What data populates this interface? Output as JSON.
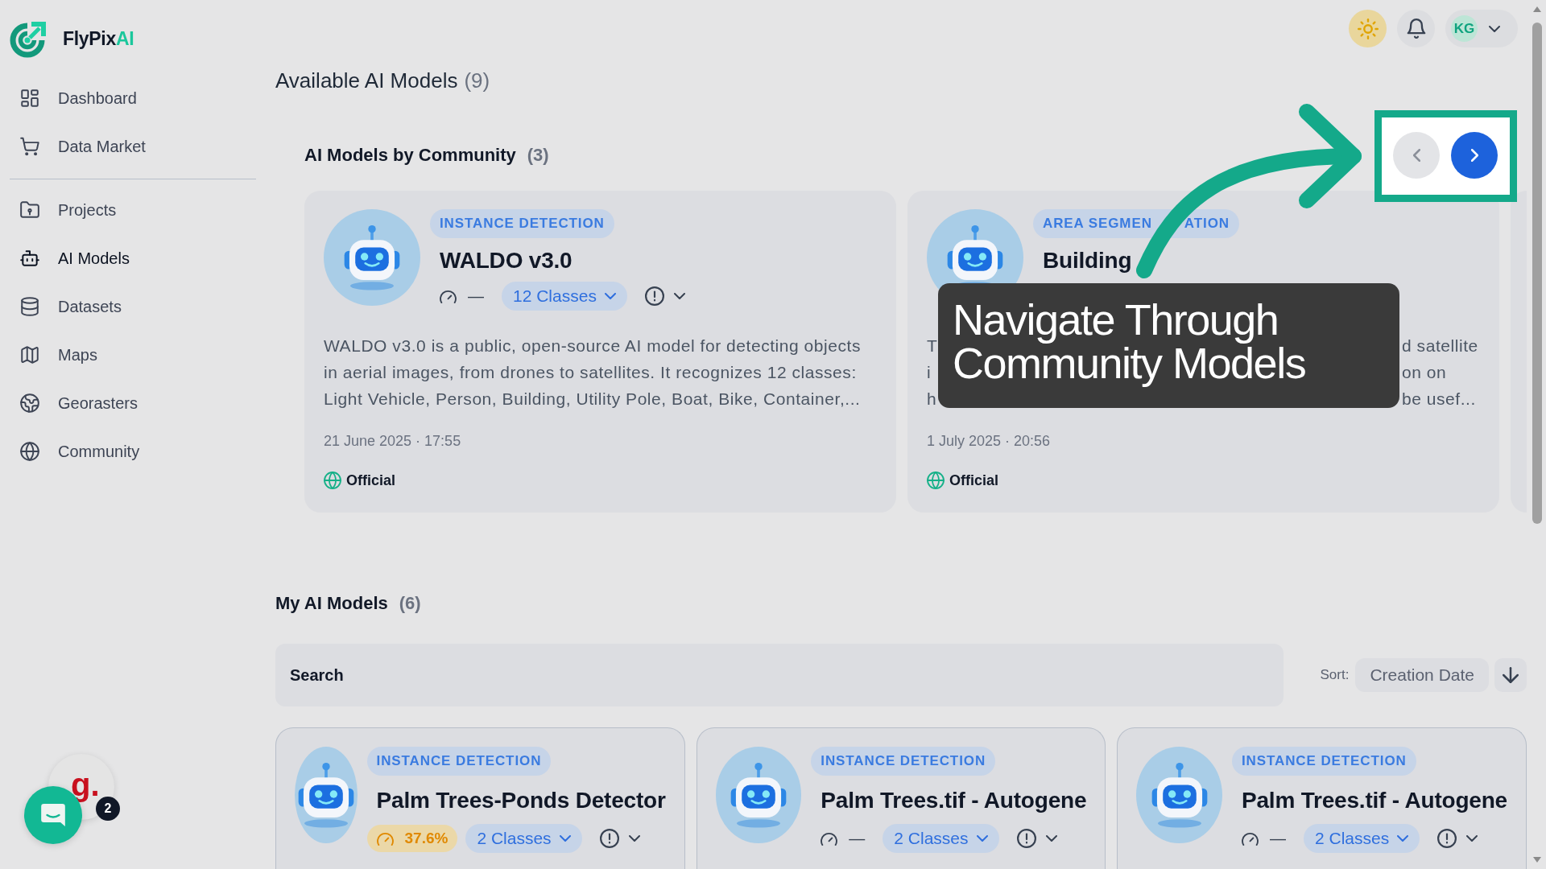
{
  "sidebar": {
    "logo": {
      "name": "FlyPix",
      "accent": "AI"
    },
    "groups": [
      [
        {
          "label": "Dashboard",
          "selected": false
        },
        {
          "label": "Data Market",
          "selected": false
        }
      ],
      [
        {
          "label": "Projects",
          "selected": false
        },
        {
          "label": "AI Models",
          "selected": true
        },
        {
          "label": "Datasets",
          "selected": false
        },
        {
          "label": "Maps",
          "selected": false
        },
        {
          "label": "Georasters",
          "selected": false
        },
        {
          "label": "Community",
          "selected": false
        }
      ]
    ]
  },
  "topbar": {
    "user_initials": "KG"
  },
  "page": {
    "title": "Available AI Models",
    "count": "(9)"
  },
  "community": {
    "title": "AI Models by Community",
    "count": "(3)",
    "pager": [
      {
        "kind": "prev",
        "disabled": true
      },
      {
        "kind": "next",
        "disabled": false
      }
    ],
    "models": [
      {
        "category": [
          "INSTANCE DETECTION"
        ],
        "name": "WALDO v3.0",
        "score": {
          "kind": "none",
          "text": "—"
        },
        "classes": "12 Classes",
        "description": [
          [
            "WALDO v3.0 is a public, open-source AI model for detecting objects"
          ],
          [
            "in aerial images, from drones to satellites. It recognizes 12 classes:"
          ],
          [
            "Light Vehicle, Person, Building, Utility Pole, Boat, Bike, Container,..."
          ]
        ],
        "date": "21 June 2025 · 17:55",
        "source": "Official"
      },
      {
        "category": [
          "AREA SEGMEN",
          "ATION"
        ],
        "name": "Building",
        "description": [
          [
            "T",
            "d satellite"
          ],
          [
            "i",
            "on on"
          ],
          [
            "h",
            "be usef..."
          ]
        ],
        "date": "1 July 2025 · 20:56",
        "source": "Official"
      }
    ]
  },
  "tour_tip": {
    "text": "Navigate Through Community Models"
  },
  "my_models": {
    "title": "My AI Models",
    "count": "(6)",
    "search": {
      "placeholder": "Search"
    },
    "sort": {
      "label": "Sort:",
      "value": "Creation Date"
    },
    "models": [
      {
        "category": [
          "INSTANCE DETECTION"
        ],
        "name": "Palm Trees-Ponds Detector",
        "score": {
          "kind": "low",
          "text": "37.6%"
        },
        "classes": "2 Classes"
      },
      {
        "category": [
          "INSTANCE DETECTION"
        ],
        "name": "Palm Trees.tif - Autogene",
        "score": {
          "kind": "none",
          "text": "—"
        },
        "classes": "2 Classes"
      },
      {
        "category": [
          "INSTANCE DETECTION"
        ],
        "name": "Palm Trees.tif - Autogene",
        "score": {
          "kind": "none",
          "text": "—"
        },
        "classes": "2 Classes"
      }
    ]
  },
  "chat_widget": {
    "logo_letter": "g.",
    "badge": "2"
  }
}
